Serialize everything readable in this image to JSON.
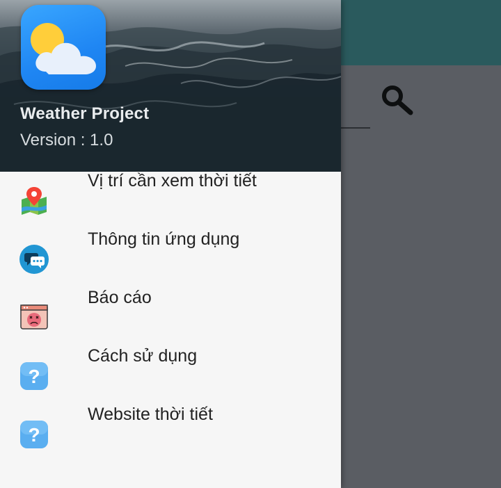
{
  "background": {
    "search_icon": "search-icon"
  },
  "drawer": {
    "header": {
      "app_name": "Weather Project",
      "version": "Version : 1.0",
      "logo_icon": "weather-sun-cloud-icon"
    },
    "menu": [
      {
        "label": "Vị trí cần xem thời tiết",
        "icon": "map-pin-icon"
      },
      {
        "label": "Thông tin ứng dụng",
        "icon": "chat-bubble-icon"
      },
      {
        "label": "Báo cáo",
        "icon": "error-report-icon"
      },
      {
        "label": "Cách sử dụng",
        "icon": "help-icon"
      },
      {
        "label": "Website thời tiết",
        "icon": "help-icon"
      }
    ]
  },
  "colors": {
    "toolbar": "#2a5a5d",
    "scrim": "#5a5d63",
    "drawer_bg": "#f6f6f6",
    "logo_blue": "#1f86f3"
  }
}
